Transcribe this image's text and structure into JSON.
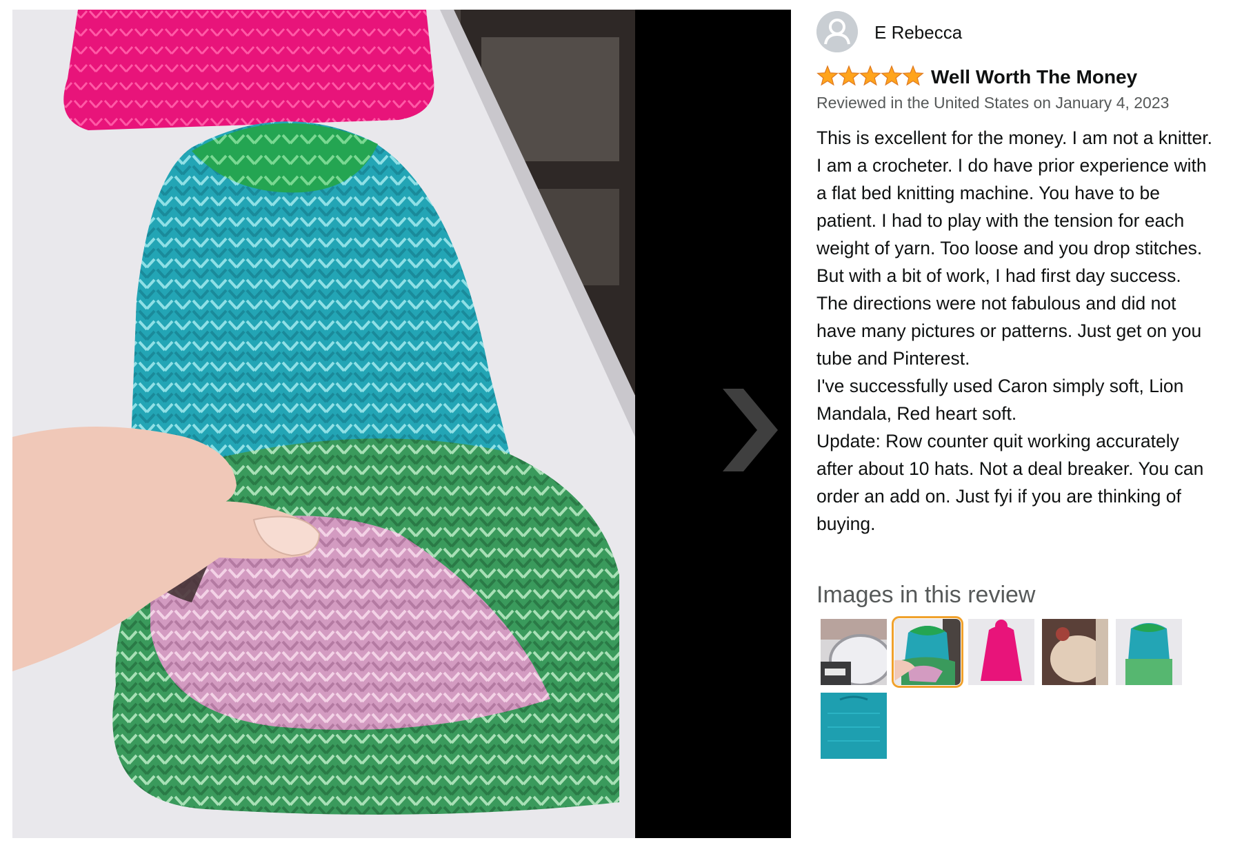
{
  "review": {
    "reviewer_name": "E Rebecca",
    "rating": 5,
    "rating_max": 5,
    "title": "Well Worth The Money",
    "date_line": "Reviewed in the United States on January 4, 2023",
    "body": [
      "This is excellent for the money. I am not a knitter. I am a crocheter. I do have prior experience with a flat bed knitting machine. You have to be patient. I had to play with the tension for each weight of yarn. Too loose and you drop stitches. But with a bit of work, I had first day success.",
      "The directions were not fabulous and did not have many pictures or patterns. Just get on you tube and Pinterest.",
      "I've successfully used Caron simply soft, Lion Mandala, Red heart soft.",
      "Update: Row counter quit working accurately after about 10 hats. Not a deal breaker. You can order an add on. Just fyi if you are thinking of buying."
    ]
  },
  "gallery": {
    "heading": "Images in this review",
    "selected_index": 1,
    "thumbnails": [
      {
        "subject": "knitting machine with row counter"
      },
      {
        "subject": "teal and green knit hat (selected)"
      },
      {
        "subject": "hot pink knit hat"
      },
      {
        "subject": "beige knit item"
      },
      {
        "subject": "teal and green knit hat"
      },
      {
        "subject": "teal knit hat"
      }
    ]
  },
  "colors": {
    "star": "#ffa41c",
    "selected_outline": "#f0a12c",
    "secondary_text": "#565959",
    "primary_text": "#0f1111"
  },
  "icons": {
    "avatar": "default-user-avatar-icon",
    "next": "chevron-right-icon",
    "star": "star-icon"
  }
}
